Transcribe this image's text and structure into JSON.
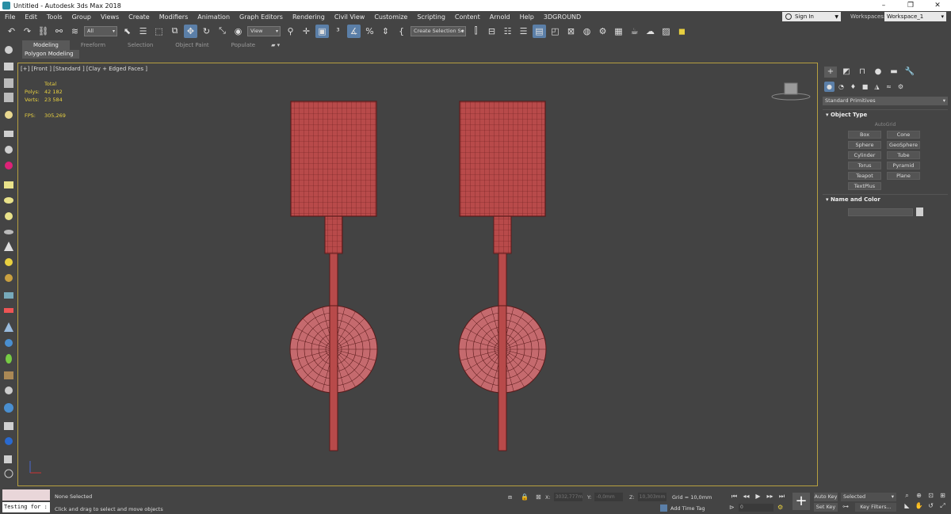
{
  "window": {
    "title": "Untitled - Autodesk 3ds Max 2018",
    "controls": [
      "–",
      "❐",
      "✕"
    ]
  },
  "menu": {
    "items": [
      "File",
      "Edit",
      "Tools",
      "Group",
      "Views",
      "Create",
      "Modifiers",
      "Animation",
      "Graph Editors",
      "Rendering",
      "Civil View",
      "Customize",
      "Scripting",
      "Content",
      "Arnold",
      "Help",
      "3DGROUND"
    ],
    "sign_in": "Sign In",
    "workspaces_label": "Workspaces:",
    "workspace_value": "Workspace_1"
  },
  "toolbar": {
    "selection_filter": "All",
    "ref_coord": "View",
    "named_selection": "Create Selection Se"
  },
  "ribbon": {
    "tabs": [
      "Modeling",
      "Freeform",
      "Selection",
      "Object Paint",
      "Populate"
    ],
    "active_tab": "Modeling",
    "sub_panel": "Polygon Modeling"
  },
  "viewport": {
    "label": "[+] [Front ] [Standard ] [Clay + Edged Faces ]",
    "stats": {
      "total_label": "Total",
      "polys_label": "Polys:",
      "polys_value": "42 182",
      "verts_label": "Verts:",
      "verts_value": "23 584",
      "fps_label": "FPS:",
      "fps_value": "305,269"
    },
    "mesh_color": "#b84a4a",
    "wire_color": "#5a1a1a",
    "background_color": "#434343",
    "active_border_color": "#b7a040"
  },
  "command_panel": {
    "primitive_type": "Standard Primitives",
    "object_type_title": "Object Type",
    "autogrid": "AutoGrid",
    "object_buttons": [
      "Box",
      "Cone",
      "Sphere",
      "GeoSphere",
      "Cylinder",
      "Tube",
      "Torus",
      "Pyramid",
      "Teapot",
      "Plane",
      "TextPlus"
    ],
    "name_color_title": "Name and Color"
  },
  "status": {
    "maxscript_input": "Testing for :",
    "selection_text": "None Selected",
    "prompt": "Click and drag to select and move objects",
    "x_label": "X:",
    "x_value": "3032,777m",
    "y_label": "Y:",
    "y_value": "-0,0mm",
    "z_label": "Z:",
    "z_value": "10,303mm",
    "grid": "Grid = 10,0mm",
    "add_time_tag": "Add Time Tag",
    "frame": "0",
    "auto_key": "Auto Key",
    "set_key": "Set Key",
    "key_mode": "Selected",
    "key_filters": "Key Filters..."
  }
}
